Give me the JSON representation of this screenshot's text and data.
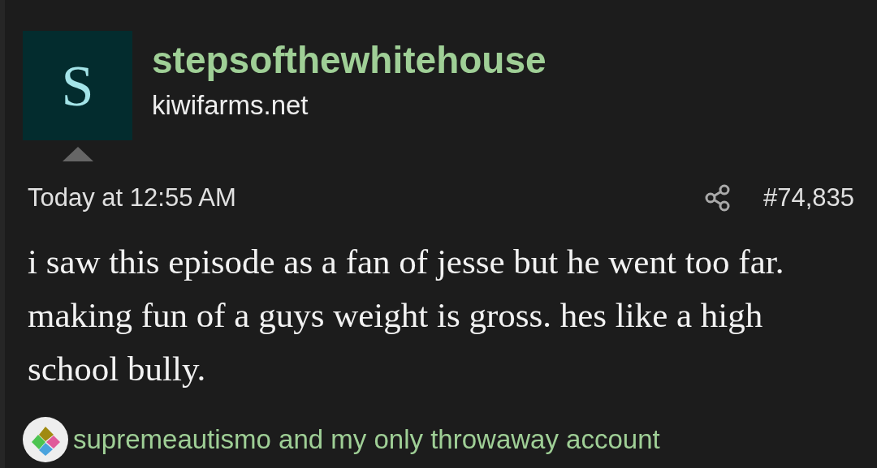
{
  "author": {
    "avatar_letter": "S",
    "username": "stepsofthewhitehouse",
    "site": "kiwifarms.net"
  },
  "post": {
    "date": "Today at 12:55 AM",
    "number": "#74,835",
    "body": "i saw this episode as a fan of jesse but he went too far. making fun of a guys weight is gross. hes like a high school bully."
  },
  "reactions": {
    "text": "supremeautismo and my only throwaway account"
  }
}
